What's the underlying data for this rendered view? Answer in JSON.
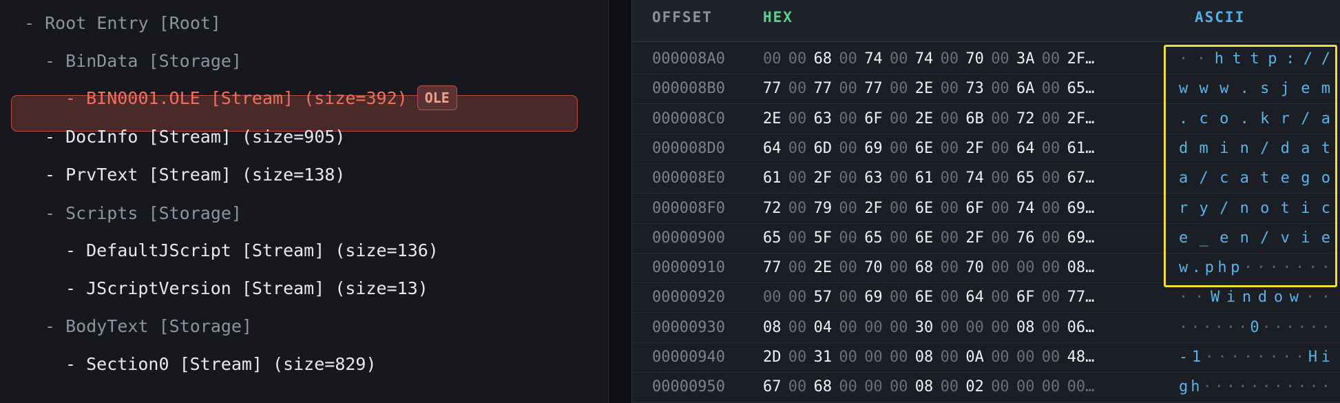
{
  "tree": {
    "items": [
      {
        "label": "- Root Entry [Root]",
        "kind": "storage",
        "depth": 0
      },
      {
        "label": "- BinData [Storage]",
        "kind": "storage",
        "depth": 1
      },
      {
        "label": "- BIN0001.OLE [Stream] (size=392)",
        "kind": "selected",
        "depth": 2,
        "badge": "OLE"
      },
      {
        "label": "- DocInfo [Stream] (size=905)",
        "kind": "stream",
        "depth": 1
      },
      {
        "label": "- PrvText [Stream] (size=138)",
        "kind": "stream",
        "depth": 1
      },
      {
        "label": "- Scripts [Storage]",
        "kind": "storage",
        "depth": 1
      },
      {
        "label": "- DefaultJScript [Stream] (size=136)",
        "kind": "stream",
        "depth": 2
      },
      {
        "label": "- JScriptVersion [Stream] (size=13)",
        "kind": "stream",
        "depth": 2
      },
      {
        "label": "- BodyText [Storage]",
        "kind": "storage",
        "depth": 1
      },
      {
        "label": "- Section0 [Stream] (size=829)",
        "kind": "stream",
        "depth": 2
      }
    ]
  },
  "hex_view": {
    "headers": {
      "offset": "OFFSET",
      "hex": "HEX",
      "ascii": "ASCII"
    },
    "rows": [
      {
        "offset": "000008A0",
        "bytes": [
          "00",
          "00",
          "68",
          "00",
          "74",
          "00",
          "74",
          "00",
          "70",
          "00",
          "3A",
          "00",
          "2F…"
        ],
        "ascii": [
          "·",
          "·",
          "h",
          "t",
          "t",
          "p",
          ":",
          "/",
          "/"
        ]
      },
      {
        "offset": "000008B0",
        "bytes": [
          "77",
          "00",
          "77",
          "00",
          "77",
          "00",
          "2E",
          "00",
          "73",
          "00",
          "6A",
          "00",
          "65…"
        ],
        "ascii": [
          "w",
          "w",
          "w",
          ".",
          "s",
          "j",
          "e",
          "m"
        ]
      },
      {
        "offset": "000008C0",
        "bytes": [
          "2E",
          "00",
          "63",
          "00",
          "6F",
          "00",
          "2E",
          "00",
          "6B",
          "00",
          "72",
          "00",
          "2F…"
        ],
        "ascii": [
          ".",
          "c",
          "o",
          ".",
          "k",
          "r",
          "/",
          "a"
        ]
      },
      {
        "offset": "000008D0",
        "bytes": [
          "64",
          "00",
          "6D",
          "00",
          "69",
          "00",
          "6E",
          "00",
          "2F",
          "00",
          "64",
          "00",
          "61…"
        ],
        "ascii": [
          "d",
          "m",
          "i",
          "n",
          "/",
          "d",
          "a",
          "t"
        ]
      },
      {
        "offset": "000008E0",
        "bytes": [
          "61",
          "00",
          "2F",
          "00",
          "63",
          "00",
          "61",
          "00",
          "74",
          "00",
          "65",
          "00",
          "67…"
        ],
        "ascii": [
          "a",
          "/",
          "c",
          "a",
          "t",
          "e",
          "g",
          "o"
        ]
      },
      {
        "offset": "000008F0",
        "bytes": [
          "72",
          "00",
          "79",
          "00",
          "2F",
          "00",
          "6E",
          "00",
          "6F",
          "00",
          "74",
          "00",
          "69…"
        ],
        "ascii": [
          "r",
          "y",
          "/",
          "n",
          "o",
          "t",
          "i",
          "c"
        ]
      },
      {
        "offset": "00000900",
        "bytes": [
          "65",
          "00",
          "5F",
          "00",
          "65",
          "00",
          "6E",
          "00",
          "2F",
          "00",
          "76",
          "00",
          "69…"
        ],
        "ascii": [
          "e",
          "_",
          "e",
          "n",
          "/",
          "v",
          "i",
          "e"
        ]
      },
      {
        "offset": "00000910",
        "bytes": [
          "77",
          "00",
          "2E",
          "00",
          "70",
          "00",
          "68",
          "00",
          "70",
          "00",
          "00",
          "00",
          "08…"
        ],
        "ascii": [
          "w",
          ".",
          "p",
          "h",
          "p",
          "·",
          "·",
          "·",
          "·",
          "·",
          "·",
          "·"
        ]
      },
      {
        "offset": "00000920",
        "bytes": [
          "00",
          "00",
          "57",
          "00",
          "69",
          "00",
          "6E",
          "00",
          "64",
          "00",
          "6F",
          "00",
          "77…"
        ],
        "ascii": [
          "·",
          "·",
          "W",
          "i",
          "n",
          "d",
          "o",
          "w",
          "·",
          "·"
        ]
      },
      {
        "offset": "00000930",
        "bytes": [
          "08",
          "00",
          "04",
          "00",
          "00",
          "00",
          "30",
          "00",
          "00",
          "00",
          "08",
          "00",
          "06…"
        ],
        "ascii": [
          "·",
          "·",
          "·",
          "·",
          "·",
          "·",
          "0",
          "·",
          "·",
          "·",
          "·",
          "·",
          "·"
        ]
      },
      {
        "offset": "00000940",
        "bytes": [
          "2D",
          "00",
          "31",
          "00",
          "00",
          "00",
          "08",
          "00",
          "0A",
          "00",
          "00",
          "00",
          "48…"
        ],
        "ascii": [
          "-",
          "1",
          "·",
          "·",
          "·",
          "·",
          "·",
          "·",
          "·",
          "·",
          "H",
          "i"
        ]
      },
      {
        "offset": "00000950",
        "bytes": [
          "67",
          "00",
          "68",
          "00",
          "00",
          "00",
          "08",
          "00",
          "02",
          "00",
          "00",
          "00",
          "00…"
        ],
        "ascii": [
          "g",
          "h",
          "·",
          "·",
          "·",
          "·",
          "·",
          "·",
          "·",
          "·",
          "·",
          "·",
          "·"
        ]
      }
    ]
  },
  "colors": {
    "selected_text": "#f0705f",
    "hex_header": "#5fcf8a",
    "ascii_text": "#57b5ec",
    "ascii_highlight": "#f0dc34"
  }
}
